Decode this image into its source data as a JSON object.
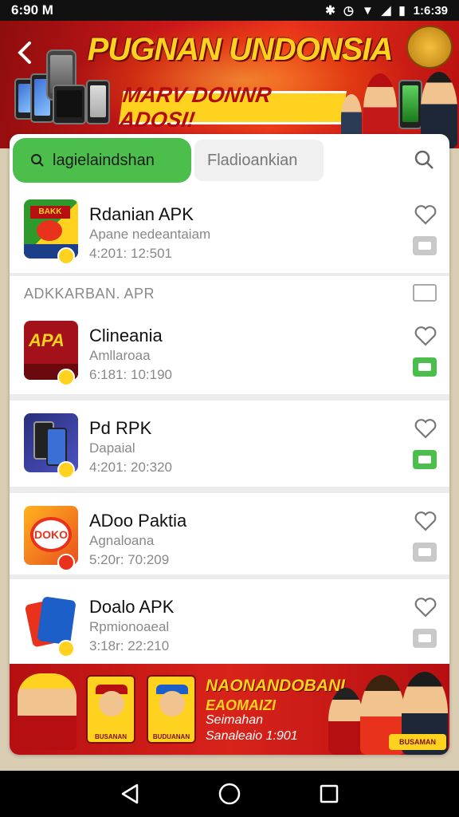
{
  "status_bar": {
    "time": "6:90 M",
    "right_time": "1:6:39",
    "icons": [
      "bluetooth-icon",
      "alarm-icon",
      "wifi-icon",
      "signal-icon",
      "battery-icon"
    ]
  },
  "hero": {
    "title": "PUGNAN UNDONSIA",
    "subtitle": "MARV DONNR ADOSI!"
  },
  "tabs": {
    "active_label": "lagielaindshan",
    "inactive_label": "Fladioankian"
  },
  "apps": [
    {
      "name": "Rdanian APK",
      "desc": "Apane nedeantaiam",
      "meta": "4:201: 12:501",
      "download_state": "grey"
    },
    {
      "name": "Clineania",
      "desc": "Amllaroaa",
      "meta": "6:181: 10:190",
      "download_state": "green"
    },
    {
      "name": "Pd RPK",
      "desc": "Dapaial",
      "meta": "4:201: 20:320",
      "download_state": "green"
    },
    {
      "name": "ADoo Paktia",
      "desc": "Agnaloana",
      "meta": "5:20r: 70:209",
      "download_state": "grey"
    },
    {
      "name": "Doalo APK",
      "desc": "Rpmionoaeal",
      "meta": "3:18r: 22:210",
      "download_state": "grey"
    }
  ],
  "section": {
    "label": "ADKKARBAN. APR"
  },
  "app_icon_text": {
    "icon1": "BAKK",
    "icon2": "APA",
    "icon4": "DOKO"
  },
  "promo": {
    "title": "NAONANDOBANI",
    "subtitle": "EAOMAIZI",
    "line1": "Seimahan",
    "line2": "Sanaleaio 1:901",
    "tile_labels": [
      "BUSANAN",
      "BUDUANAN",
      "BUSAMAN"
    ]
  },
  "colors": {
    "accent_green": "#4cbe4c",
    "brand_red": "#c8171a",
    "brand_yellow": "#ffd21f"
  }
}
